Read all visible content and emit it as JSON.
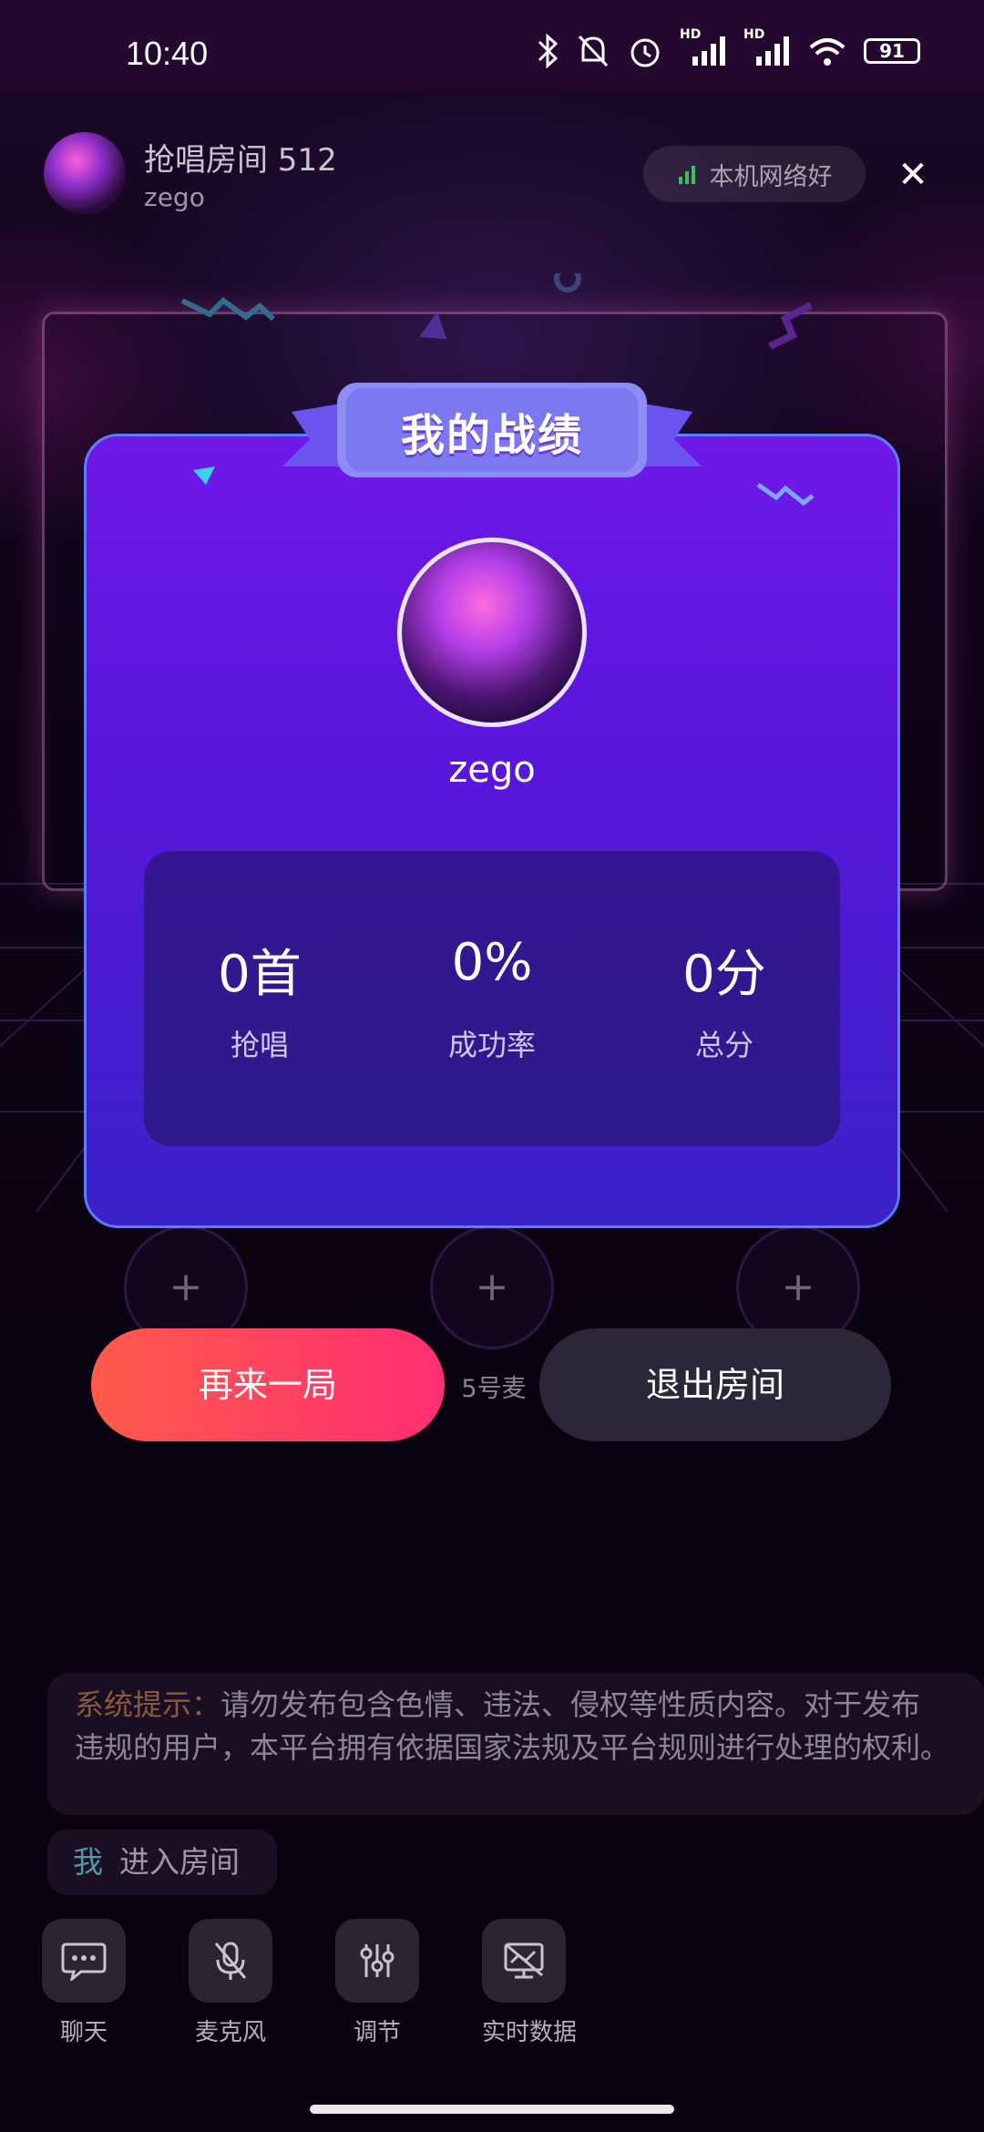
{
  "status_bar": {
    "time": "10:40",
    "battery": "91",
    "network_labels": [
      "HD",
      "HD"
    ]
  },
  "room": {
    "title": "抢唱房间 512",
    "host": "zego",
    "network_status": "本机网络好"
  },
  "result_card": {
    "banner": "我的战绩",
    "player_name": "zego",
    "stats": [
      {
        "value": "0首",
        "label": "抢唱"
      },
      {
        "value": "0%",
        "label": "成功率"
      },
      {
        "value": "0分",
        "label": "总分"
      }
    ]
  },
  "seats": {
    "add_symbol": "+",
    "mic_label": "5号麦"
  },
  "actions": {
    "again_label": "再来一局",
    "exit_label": "退出房间"
  },
  "chat": {
    "system_label": "系统提示：",
    "system_message": "请勿发布包含色情、违法、侵权等性质内容。对于发布违规的用户，本平台拥有依据国家法规及平台规则进行处理的权利。",
    "enter_user": "我",
    "enter_text": "进入房间"
  },
  "toolbar": [
    {
      "label": "聊天",
      "icon": "chat-icon"
    },
    {
      "label": "麦克风",
      "icon": "mic-off-icon"
    },
    {
      "label": "调节",
      "icon": "sliders-icon"
    },
    {
      "label": "实时数据",
      "icon": "realtime-data-icon"
    }
  ],
  "colors": {
    "accent_start": "#ff5a4a",
    "accent_end": "#ff2e74",
    "card": "#5a16dc",
    "card_border": "#5d7bff"
  }
}
